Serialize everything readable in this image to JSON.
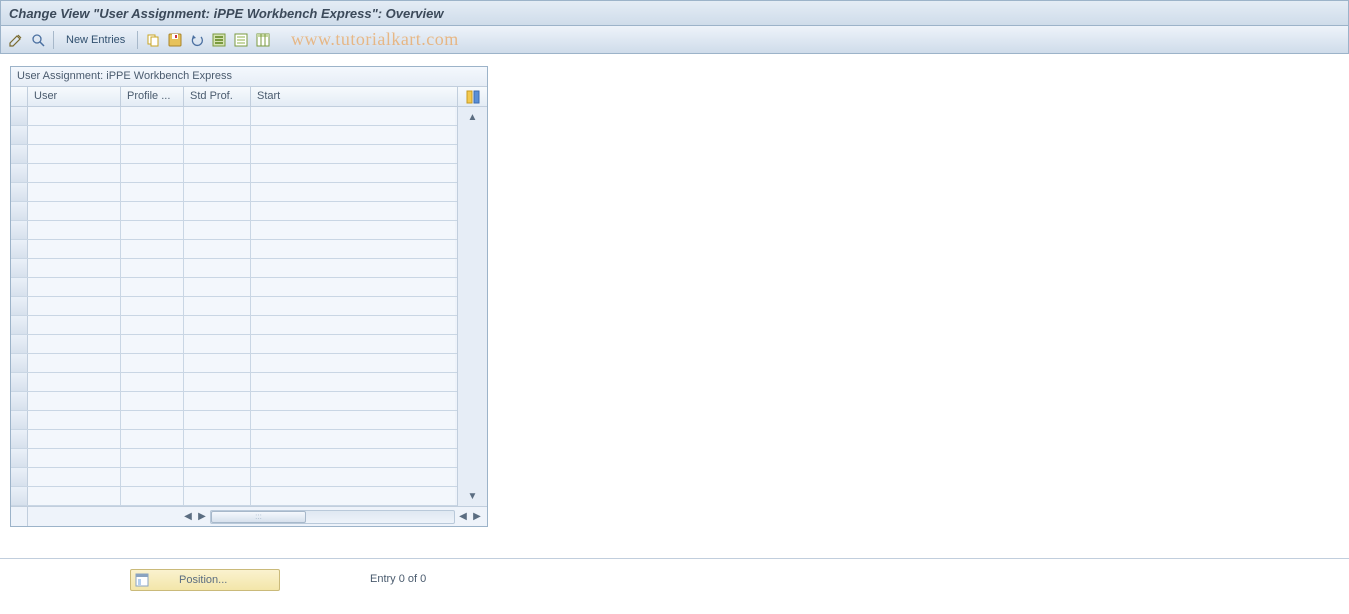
{
  "title": "Change View \"User Assignment: iPPE Workbench Express\": Overview",
  "toolbar": {
    "new_entries_label": "New Entries"
  },
  "watermark_text": "www.tutorialkart.com",
  "panel": {
    "title": "User Assignment: iPPE Workbench Express",
    "columns": {
      "user": "User",
      "profile": "Profile ...",
      "std_prof": "Std Prof.",
      "start": "Start"
    },
    "rows": [
      {},
      {},
      {},
      {},
      {},
      {},
      {},
      {},
      {},
      {},
      {},
      {},
      {},
      {},
      {},
      {},
      {},
      {},
      {},
      {},
      {}
    ]
  },
  "footer": {
    "position_label": "Position...",
    "entry_status": "Entry 0 of 0"
  }
}
